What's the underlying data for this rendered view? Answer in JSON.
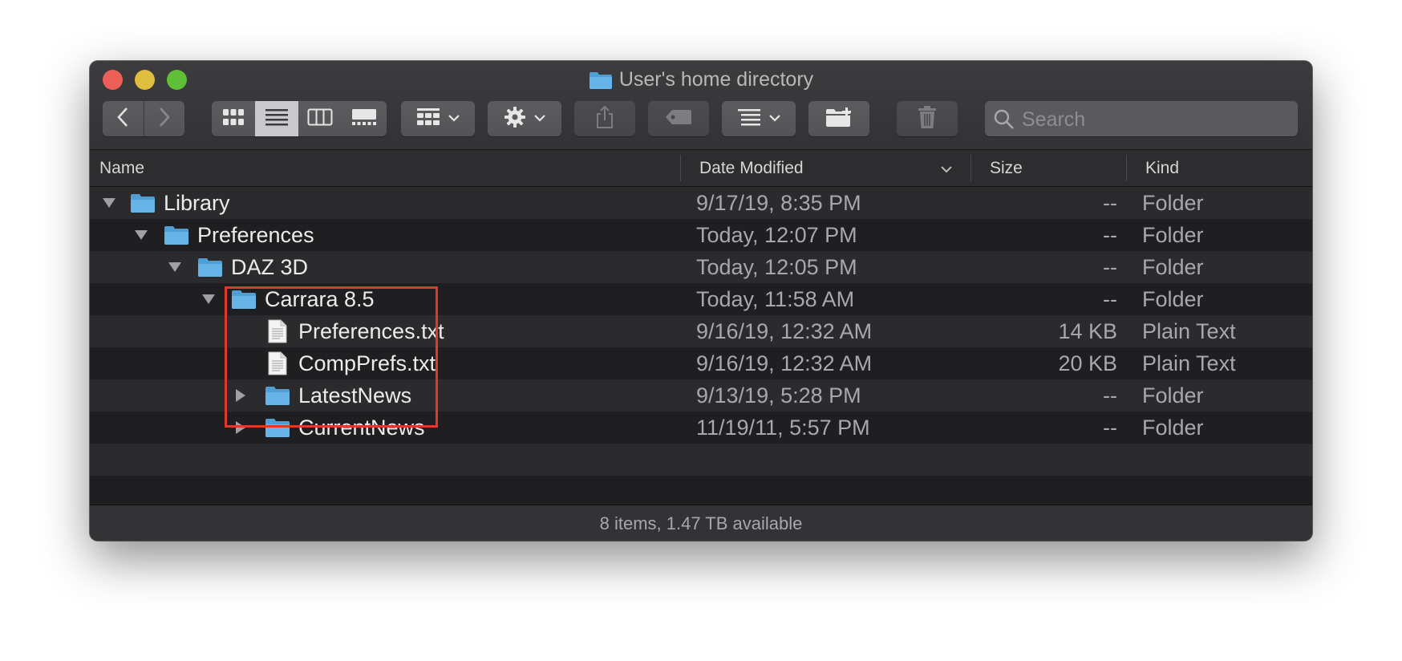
{
  "window": {
    "title": "User's home directory"
  },
  "toolbar": {
    "icons": [
      "chevron-left",
      "chevron-right",
      "grid",
      "list",
      "columns",
      "gallery",
      "group",
      "gear",
      "share",
      "tag",
      "sort",
      "new-folder",
      "trash"
    ]
  },
  "search": {
    "placeholder": "Search",
    "value": ""
  },
  "columns": {
    "name": "Name",
    "date": "Date Modified",
    "size": "Size",
    "kind": "Kind"
  },
  "rows": [
    {
      "name": "Library",
      "date": "9/17/19, 8:35 PM",
      "size": "--",
      "kind": "Folder",
      "type": "folder",
      "expanded": true
    },
    {
      "name": "Preferences",
      "date": "Today, 12:07 PM",
      "size": "--",
      "kind": "Folder",
      "type": "folder",
      "expanded": true
    },
    {
      "name": "DAZ 3D",
      "date": "Today, 12:05 PM",
      "size": "--",
      "kind": "Folder",
      "type": "folder",
      "expanded": true
    },
    {
      "name": "Carrara 8.5",
      "date": "Today, 11:58 AM",
      "size": "--",
      "kind": "Folder",
      "type": "folder",
      "expanded": true
    },
    {
      "name": "Preferences.txt",
      "date": "9/16/19, 12:32 AM",
      "size": "14 KB",
      "kind": "Plain Text",
      "type": "file"
    },
    {
      "name": "CompPrefs.txt",
      "date": "9/16/19, 12:32 AM",
      "size": "20 KB",
      "kind": "Plain Text",
      "type": "file"
    },
    {
      "name": "LatestNews",
      "date": "9/13/19, 5:28 PM",
      "size": "--",
      "kind": "Folder",
      "type": "folder",
      "expanded": false
    },
    {
      "name": "CurrentNews",
      "date": "11/19/11, 5:57 PM",
      "size": "--",
      "kind": "Folder",
      "type": "folder",
      "expanded": false
    }
  ],
  "status": {
    "text": "8 items, 1.47 TB available"
  },
  "colors": {
    "highlight": "#e1382b",
    "folder": "#63b2e5",
    "close": "#ec5f57",
    "minimize": "#dfbe3f",
    "maximize": "#5fc038"
  }
}
